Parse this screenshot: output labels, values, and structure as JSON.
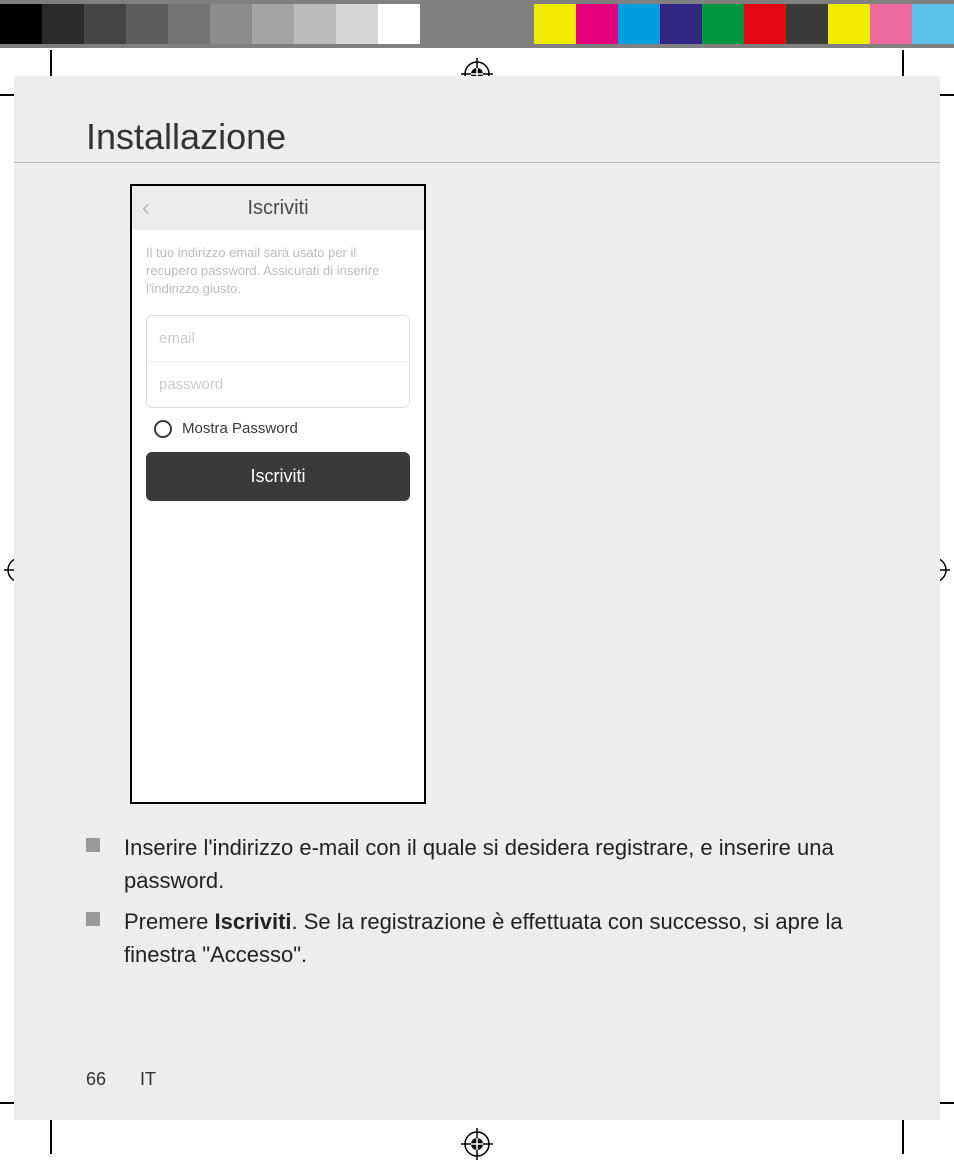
{
  "section_title": "Installazione",
  "phone": {
    "title": "Iscriviti",
    "helper": "Il tuo indirizzo email sarà usato per il recupero password. Assicurati di inserire l'indirizzo giusto.",
    "email_placeholder": "email",
    "password_placeholder": "password",
    "show_password_label": "Mostra Password",
    "submit_label": "Iscriviti"
  },
  "instructions": {
    "item1": "Inserire l'indirizzo e-mail con il quale si desidera registrare, e inserire una password.",
    "item2_pre": "Premere ",
    "item2_bold": "Iscriviti",
    "item2_post": ". Se la registrazione è effettuata con successo, si apre la finestra \"Accesso\"."
  },
  "footer": {
    "page": "66",
    "lang": "IT"
  },
  "color_strip": {
    "left": [
      "#000000",
      "#2b2b2b",
      "#444444",
      "#5c5c5c",
      "#747474",
      "#8c8c8c",
      "#a4a4a4",
      "#bcbcbc",
      "#d6d6d6",
      "#ffffff"
    ],
    "right": [
      "#f2ea00",
      "#e6007e",
      "#009ee0",
      "#312783",
      "#009640",
      "#e30613",
      "#3a3a3a",
      "#f2ea00",
      "#ec6aa0",
      "#5bc4e6"
    ]
  }
}
